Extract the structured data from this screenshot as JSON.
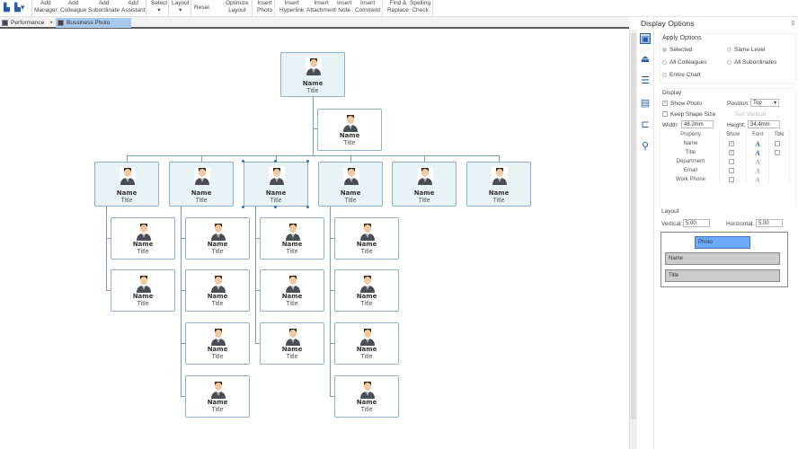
{
  "toolbar": {
    "items": [
      "Add\nManager",
      "Add\nColleague",
      "Add\nSubordinate",
      "Add\nAssistant",
      "Select\n▾",
      "Layout\n▾",
      "Reset",
      "Optimize\nLayout",
      "Insert\nPhoto",
      "Insert\nHyperlink",
      "Insert\nAttachment",
      "Insert\nNote",
      "Insert\nComment",
      "Find &\nReplace",
      "Spelling\nCheck"
    ]
  },
  "tabs": [
    {
      "label": "Performance",
      "close": "×"
    },
    {
      "label": "Bussiness Photo Or...",
      "close": "×"
    }
  ],
  "chart": {
    "root": {
      "name": "Name",
      "title": "Title"
    },
    "assistant": {
      "name": "Name",
      "title": "Title"
    },
    "level1": [
      {
        "name": "Name",
        "title": "Title",
        "children": 2
      },
      {
        "name": "Name",
        "title": "Title",
        "children": 4
      },
      {
        "name": "Name",
        "title": "Title",
        "children": 3
      },
      {
        "name": "Name",
        "title": "Title",
        "children": 4
      },
      {
        "name": "Name",
        "title": "Title",
        "children": 0
      },
      {
        "name": "Name",
        "title": "Title",
        "children": 0
      }
    ],
    "child": {
      "name": "Name",
      "title": "Title"
    }
  },
  "panel": {
    "title": "Display Options",
    "apply_options": {
      "label": "Apply Options",
      "options": [
        "Selected",
        "Same Level",
        "All Colleagues",
        "All Subordinates",
        "Entire Chart"
      ],
      "selected": "Selected"
    },
    "display": {
      "label": "Display",
      "show_photo": "Show Photo",
      "position_label": "Position:",
      "position": "Top",
      "keep_shape": "Keep Shape Size",
      "text_vertical": "Text Vertical",
      "width_label": "Width:",
      "width": "48.2mm",
      "height_label": "Height:",
      "height": "34.4mm",
      "columns": [
        "Property",
        "Show",
        "Font",
        "Title"
      ],
      "rows": [
        {
          "p": "Name",
          "show": true,
          "title": false
        },
        {
          "p": "Title",
          "show": true,
          "title": false
        },
        {
          "p": "Department",
          "show": false
        },
        {
          "p": "Email",
          "show": false
        },
        {
          "p": "Work Phone",
          "show": false
        }
      ],
      "font_glyph": "A"
    },
    "layout": {
      "label": "Layout",
      "vertical_label": "Vertical:",
      "vertical": "5.00",
      "horizontal_label": "Horizontal:",
      "horizontal": "5.00",
      "preview": [
        "Photo",
        "Name",
        "Title"
      ]
    }
  }
}
